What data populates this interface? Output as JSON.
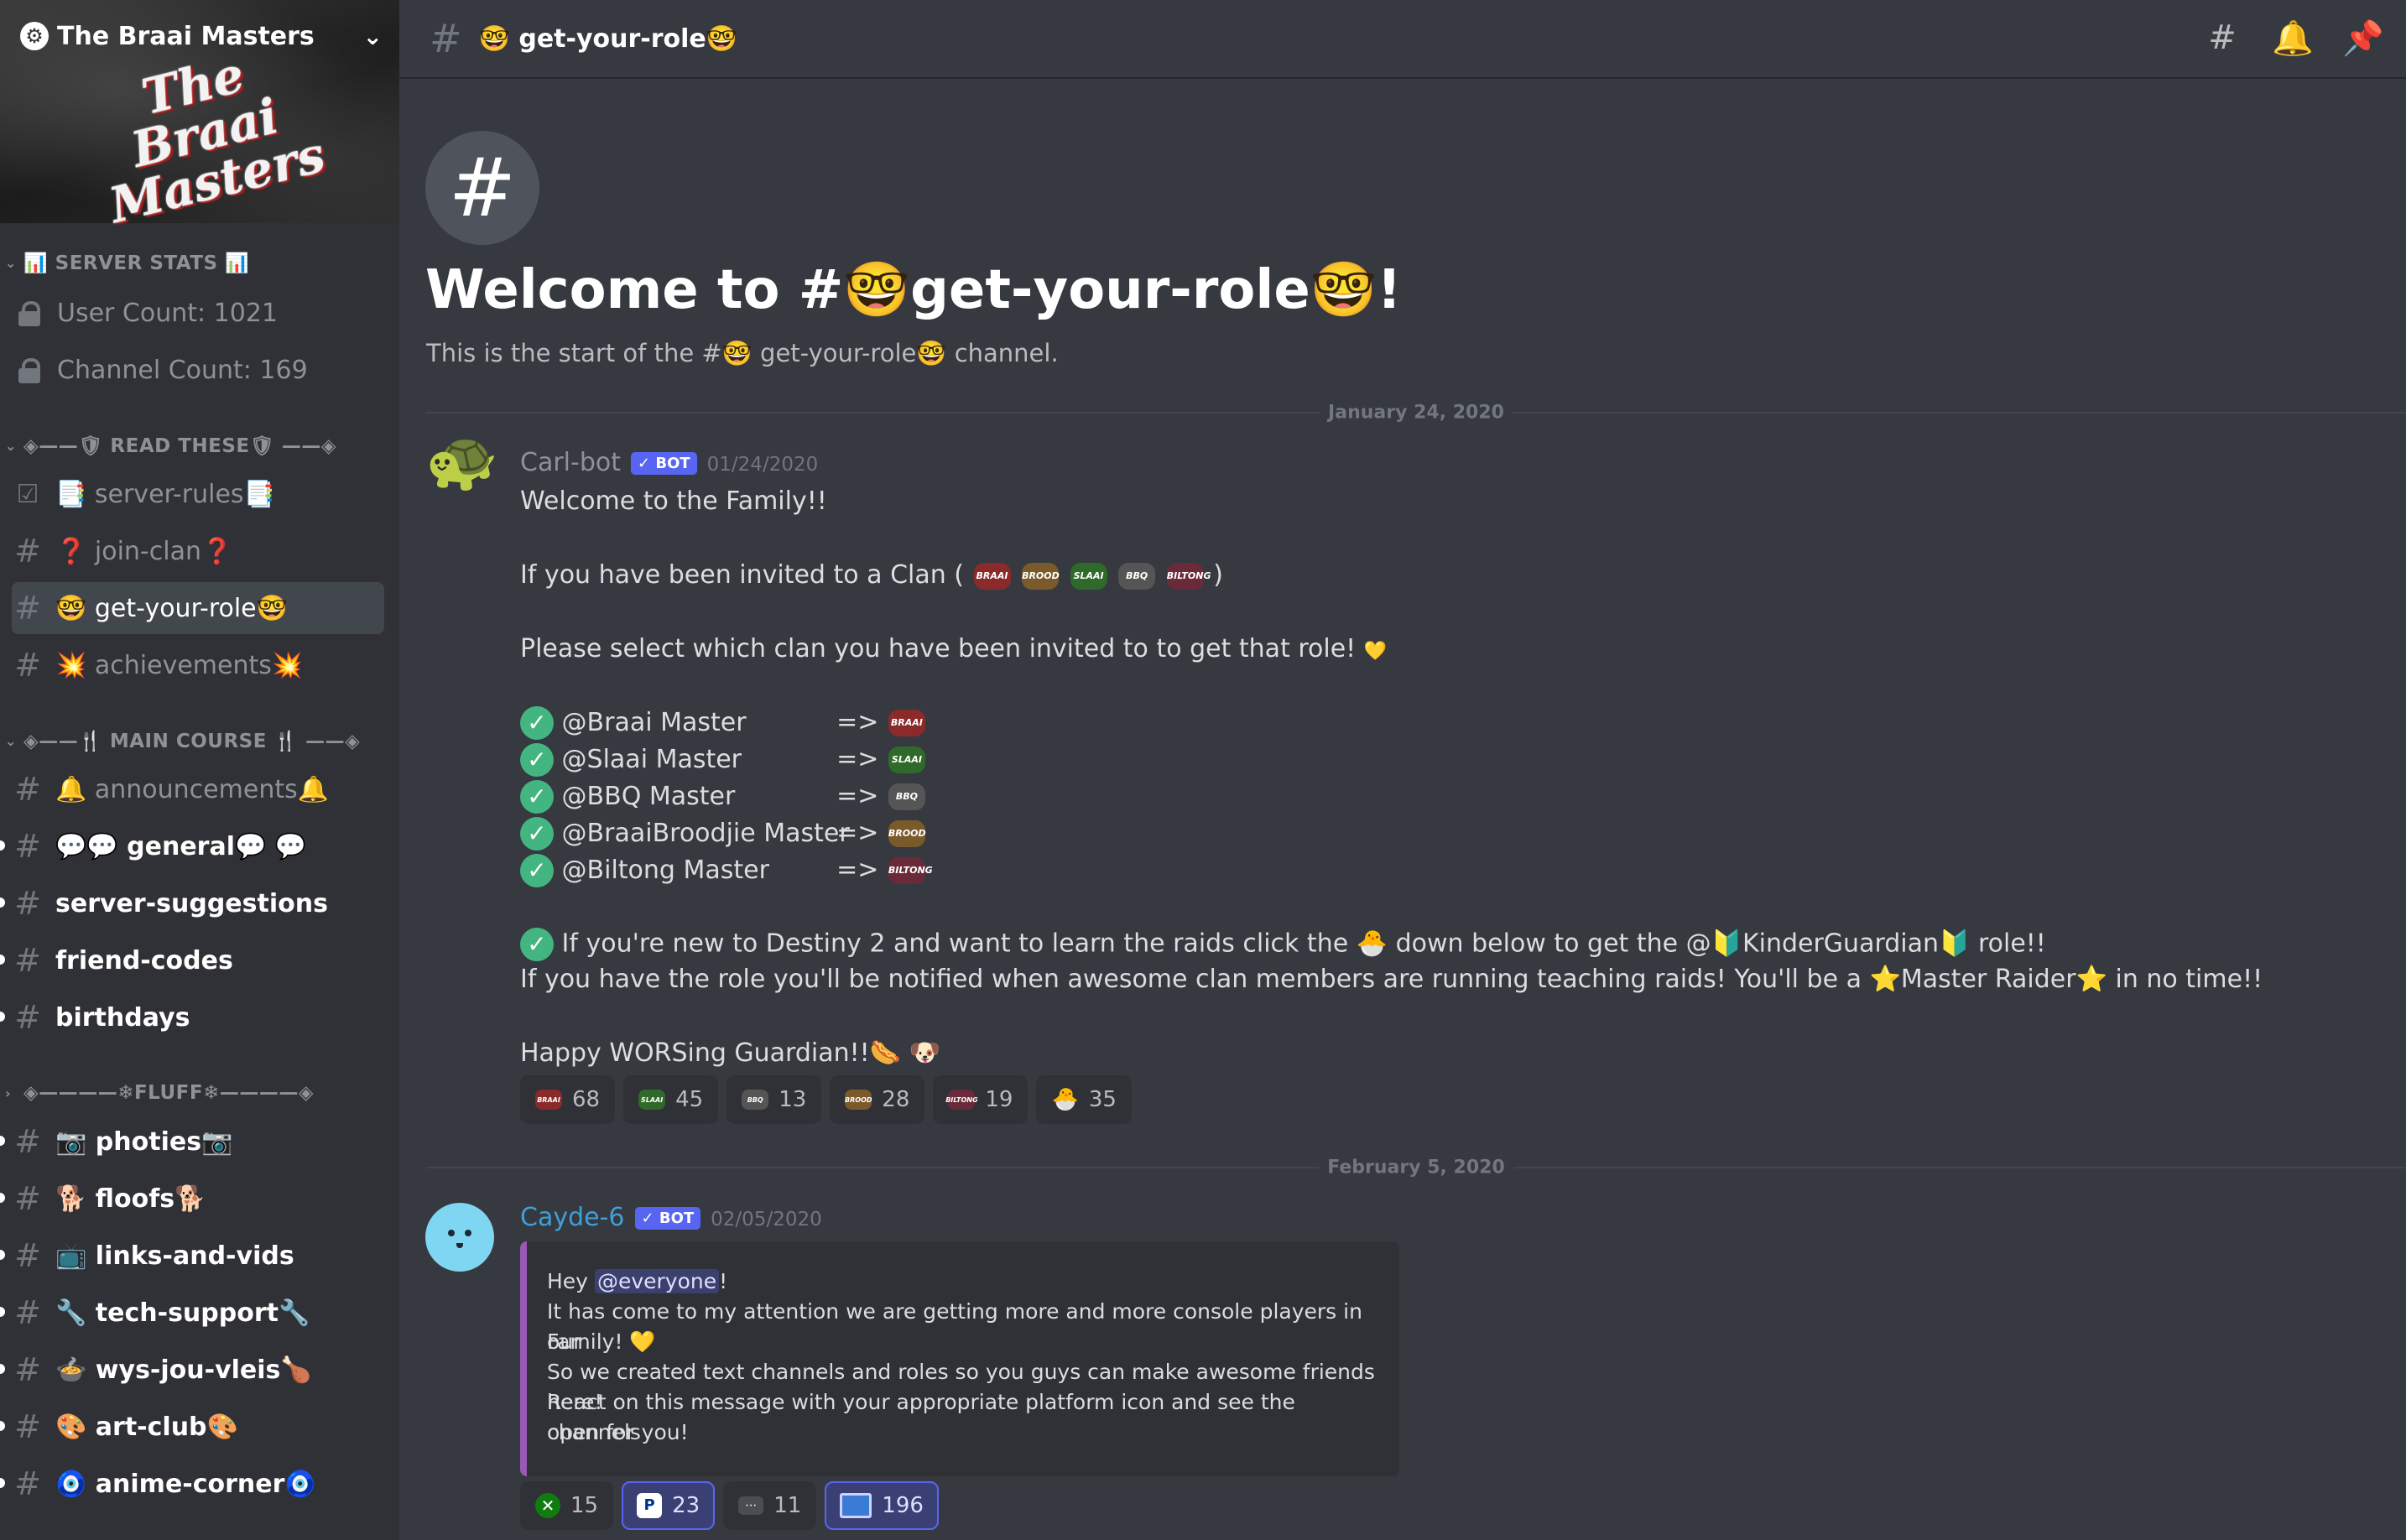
{
  "server": {
    "name": "The Braai Masters",
    "banner_logo": "The Braai Masters"
  },
  "sidebar": {
    "categories": [
      {
        "label": "📊 SERVER STATS 📊"
      },
      {
        "label": "◈——🛡 READ THESE🛡 ——◈"
      },
      {
        "label": "◈——🍴 MAIN COURSE 🍴 ——◈"
      },
      {
        "label": "◈————❄FLUFF❄————◈"
      }
    ],
    "locked": [
      {
        "label": "User Count: 1021"
      },
      {
        "label": "Channel Count: 169"
      }
    ],
    "channels": [
      {
        "label": "📑 server-rules📑"
      },
      {
        "label": "❓ join-clan❓"
      },
      {
        "label": "🤓 get-your-role🤓"
      },
      {
        "label": "💥 achievements💥"
      },
      {
        "label": "🔔 announcements🔔"
      },
      {
        "label": "💬💬 general💬 💬"
      },
      {
        "label": "server-suggestions"
      },
      {
        "label": "friend-codes"
      },
      {
        "label": "birthdays"
      },
      {
        "label": "📷 photies📷"
      },
      {
        "label": "🐕 floofs🐕"
      },
      {
        "label": "📺 links-and-vids"
      },
      {
        "label": "🔧 tech-support🔧"
      },
      {
        "label": "🍲 wys-jou-vleis🍗"
      },
      {
        "label": "🎨 art-club🎨"
      },
      {
        "label": "🧿 anime-corner🧿"
      }
    ]
  },
  "header": {
    "channel_title": "🤓 get-your-role🤓"
  },
  "intro": {
    "title": "Welcome to #🤓get-your-role🤓!",
    "subtitle": "This is the start of the #🤓 get-your-role🤓  channel."
  },
  "dividers": [
    "January 24, 2020",
    "February 5, 2020"
  ],
  "message1": {
    "author": "Carl-bot",
    "bot_label": "✓ BOT",
    "timestamp": "01/24/2020",
    "l1": "Welcome to the Family!!",
    "l2a": "If you have been invited to a Clan (",
    "l2b": ")",
    "l3": "Please select which clan you have been invited to to get that role!",
    "roles": [
      {
        "name": "@Braai Master",
        "arrow": "=>",
        "icon": "BRAAI"
      },
      {
        "name": "@Slaai Master",
        "arrow": "=>",
        "icon": "SLAAI"
      },
      {
        "name": "@BBQ Master",
        "arrow": "=>",
        "icon": "BBQ"
      },
      {
        "name": "@BraaiBroodjie Master",
        "arrow": "=>",
        "icon": "BROOD"
      },
      {
        "name": "@Biltong Master",
        "arrow": "=>",
        "icon": "BILTONG"
      }
    ],
    "l4a": "If you're new to Destiny 2 and want to learn the raids click the",
    "l4b": "down below to get the @",
    "l4c": "KinderGuardian",
    "l4d": "role!!",
    "l5a": "If you have the role you'll be notified when awesome clan members are running teaching raids! You'll be a",
    "l5b": "Master Raider",
    "l5c": "in no time!!",
    "l6": "Happy WORSing Guardian!!",
    "reactions": [
      {
        "icon": "BRAAI",
        "count": "68"
      },
      {
        "icon": "SLAAI",
        "count": "45"
      },
      {
        "icon": "BBQ",
        "count": "13"
      },
      {
        "icon": "BROOD",
        "count": "28"
      },
      {
        "icon": "BILTONG",
        "count": "19"
      },
      {
        "icon": "🐣",
        "count": "35"
      }
    ]
  },
  "message2": {
    "author": "Cayde-6",
    "bot_label": "✓ BOT",
    "timestamp": "02/05/2020",
    "e1a": "Hey",
    "e1b": "@everyone",
    "e1c": "!",
    "e2": "It has come to my attention we are getting more and more console players in our",
    "e3": "Family! 💛",
    "e4": "So we created text channels and roles so you guys can make awesome friends here!",
    "e5": "React on this message with your appropriate platform icon and see the channels",
    "e6": "open for you!",
    "reactions": [
      {
        "icon": "xbox-icon",
        "count": "15"
      },
      {
        "icon": "playstation-icon",
        "count": "23"
      },
      {
        "icon": "switch-icon",
        "count": "11"
      },
      {
        "icon": "pc-icon",
        "count": "196"
      }
    ]
  },
  "colors": {
    "accent": "#5865f2",
    "bg": "#36393f",
    "sidebar": "#2f3136",
    "carl_name": "#8e9297",
    "cayde_name": "#3ba55d",
    "embed_bar": "#9b59b6"
  }
}
